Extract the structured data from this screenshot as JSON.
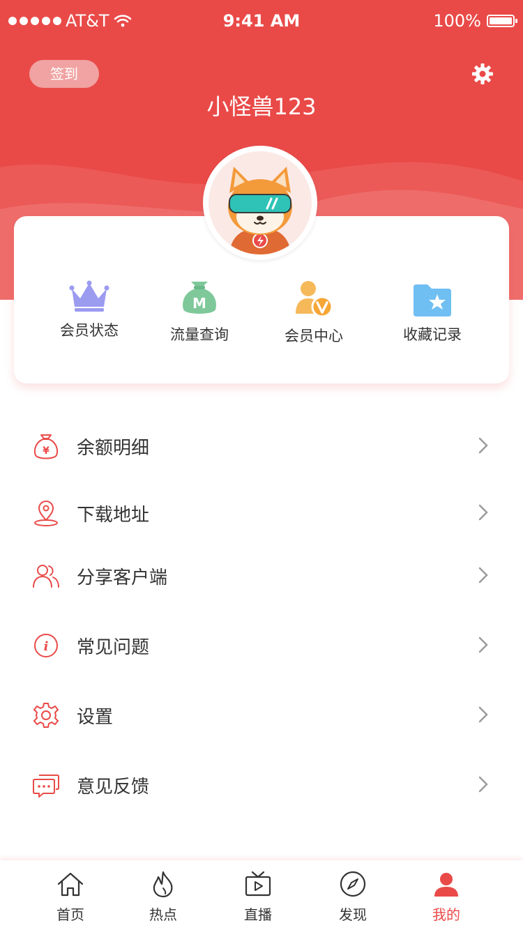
{
  "status_bar": {
    "carrier": "AT&T",
    "time": "9:41 AM",
    "battery": "100%"
  },
  "header": {
    "checkin_label": "签到",
    "username": "小怪兽123"
  },
  "quick_actions": [
    {
      "label": "会员状态",
      "icon": "crown-icon"
    },
    {
      "label": "流量查询",
      "icon": "money-bag-icon"
    },
    {
      "label": "会员中心",
      "icon": "vip-user-icon"
    },
    {
      "label": "收藏记录",
      "icon": "star-folder-icon"
    }
  ],
  "menu": [
    {
      "label": "余额明细",
      "icon": "yen-bag-icon"
    },
    {
      "label": "下载地址",
      "icon": "location-pin-icon"
    },
    {
      "label": "分享客户端",
      "icon": "users-icon"
    },
    {
      "label": "常见问题",
      "icon": "info-icon"
    },
    {
      "label": "设置",
      "icon": "gear-icon"
    },
    {
      "label": "意见反馈",
      "icon": "chat-bubbles-icon"
    }
  ],
  "tabs": [
    {
      "label": "首页",
      "icon": "home-icon"
    },
    {
      "label": "热点",
      "icon": "flame-icon"
    },
    {
      "label": "直播",
      "icon": "tv-icon"
    },
    {
      "label": "发现",
      "icon": "compass-icon"
    },
    {
      "label": "我的",
      "icon": "user-icon",
      "active": true
    }
  ],
  "colors": {
    "accent": "#e94a48",
    "text": "#333333",
    "arrow": "#9b9b9b"
  }
}
